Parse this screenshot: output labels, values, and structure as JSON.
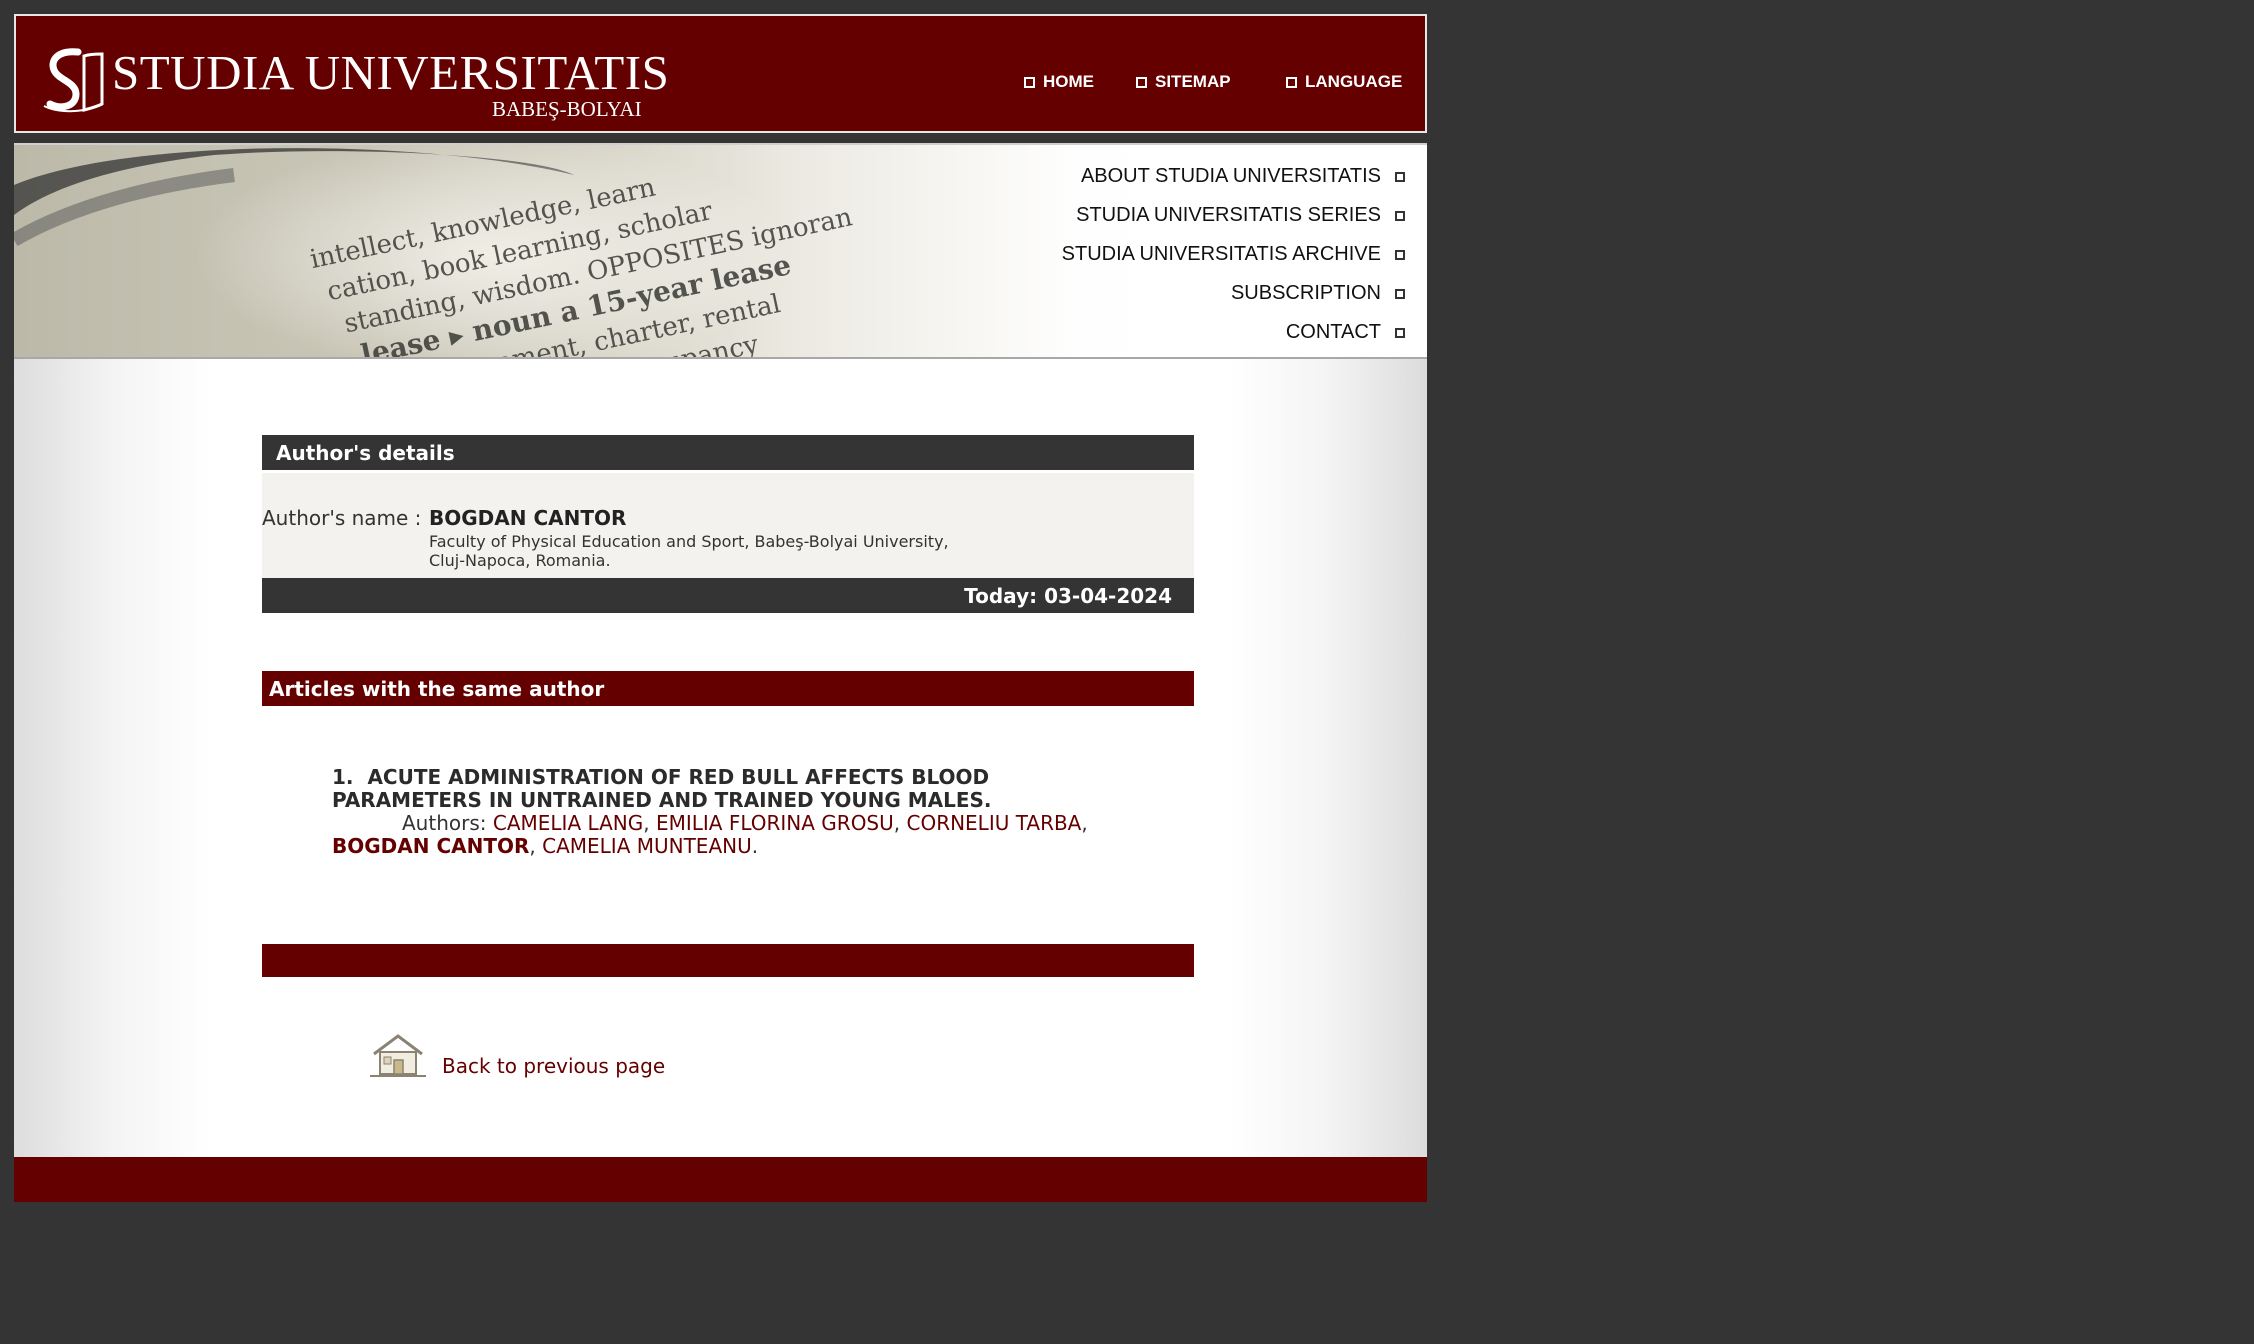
{
  "header": {
    "logo_title": "STUDIA UNIVERSITATIS",
    "logo_subtitle": "BABEŞ-BOLYAI",
    "nav": [
      "HOME",
      "SITEMAP",
      "LANGUAGE"
    ]
  },
  "menu": [
    "ABOUT STUDIA UNIVERSITATIS",
    "STUDIA UNIVERSITATIS SERIES",
    "STUDIA UNIVERSITATIS ARCHIVE",
    "SUBSCRIPTION",
    "CONTACT"
  ],
  "author_details": {
    "heading": "Author's details",
    "name_label": "Author's name :",
    "name": "BOGDAN CANTOR",
    "affiliation_line1": "Faculty of Physical Education and Sport, Babeş-Bolyai University,",
    "affiliation_line2": "Cluj-Napoca, Romania.",
    "today": "Today: 03-04-2024"
  },
  "articles": {
    "heading": "Articles with the same author",
    "items": [
      {
        "number": "1.",
        "title_line1": "ACUTE ADMINISTRATION OF RED BULL AFFECTS BLOOD",
        "title_line2": "PARAMETERS IN UNTRAINED AND TRAINED YOUNG MALES.",
        "authors_label": "Authors:",
        "authors": [
          "CAMELIA LANG",
          "EMILIA FLORINA GROSU",
          "CORNELIU TARBA",
          "BOGDAN CANTOR",
          "CAMELIA MUNTEANU"
        ]
      }
    ]
  },
  "back_link": "Back to previous page",
  "colors": {
    "brand": "#650000",
    "dark_bar": "#343434",
    "page_bg": "#343434"
  },
  "icons": [
    "logo-s-icon",
    "house-icon",
    "square-bullet-icon"
  ]
}
